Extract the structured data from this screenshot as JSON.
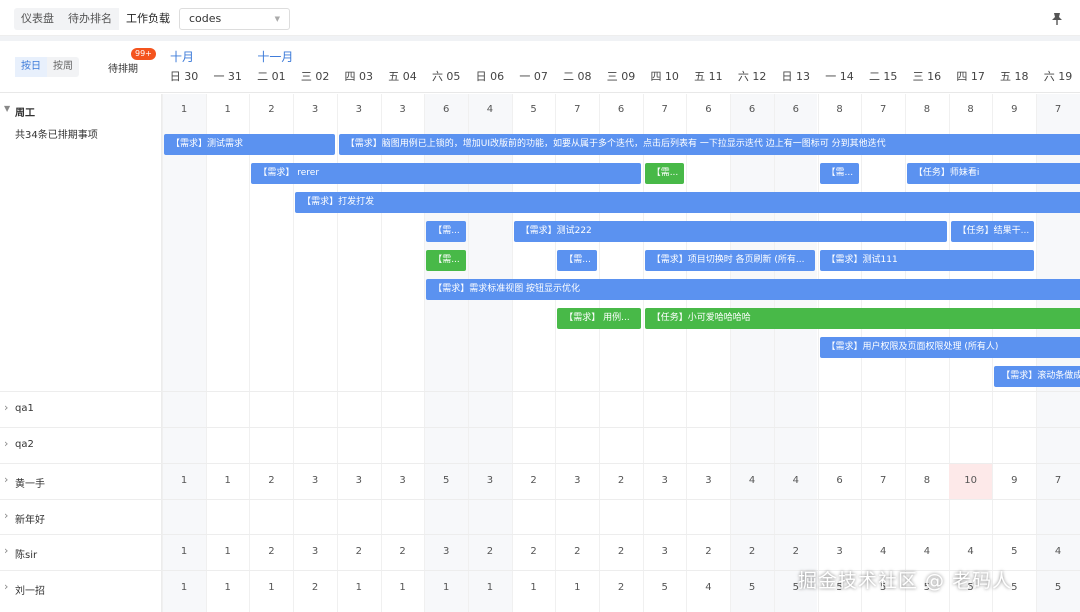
{
  "tabs": [
    {
      "label": "仪表盘"
    },
    {
      "label": "待办排名"
    },
    {
      "label": "工作负载"
    }
  ],
  "select": {
    "value": "codes"
  },
  "header": {
    "seg": [
      "按日",
      "按周"
    ],
    "pending": "待排期",
    "badge": "99+"
  },
  "months": [
    {
      "label": "十月",
      "col": 0
    },
    {
      "label": "十一月",
      "col": 2
    }
  ],
  "days": [
    "日 30",
    "一 31",
    "二 01",
    "三 02",
    "四 03",
    "五 04",
    "六 05",
    "日 06",
    "一 07",
    "二 08",
    "三 09",
    "四 10",
    "五 11",
    "六 12",
    "日 13",
    "一 14",
    "二 15",
    "三 16",
    "四 17",
    "五 18",
    "六 19"
  ],
  "weekend_cols": [
    0,
    6,
    7,
    13,
    14,
    20
  ],
  "zhougong": {
    "name": "周工",
    "summary": "共34条已排期事项",
    "counts": [
      "1",
      "1",
      "2",
      "3",
      "3",
      "3",
      "6",
      "4",
      "5",
      "7",
      "6",
      "7",
      "6",
      "6",
      "6",
      "8",
      "7",
      "8",
      "8",
      "9",
      "7"
    ]
  },
  "tasks": [
    {
      "row": 0,
      "start": 0,
      "end": 3,
      "label": "【需求】测试需求",
      "color": "blue"
    },
    {
      "row": 0,
      "start": 4,
      "end": 21,
      "label": "【需求】脑图用例已上锁的，增加UI改版前的功能，如要从属于多个迭代，点击后列表有 一下拉显示迭代 边上有一图标可 分到其他迭代",
      "color": "blue"
    },
    {
      "row": 1,
      "start": 2,
      "end": 10,
      "label": "【需求】 rerer",
      "color": "blue"
    },
    {
      "row": 1,
      "start": 11,
      "end": 11,
      "label": "【需...",
      "color": "green"
    },
    {
      "row": 1,
      "start": 15,
      "end": 15,
      "label": "【需...",
      "color": "blue"
    },
    {
      "row": 1,
      "start": 17,
      "end": 21,
      "label": "【任务】师妹看i",
      "color": "blue"
    },
    {
      "row": 2,
      "start": 3,
      "end": 21,
      "label": "【需求】打发打发",
      "color": "blue"
    },
    {
      "row": 3,
      "start": 6,
      "end": 6,
      "label": "【需...",
      "color": "blue"
    },
    {
      "row": 3,
      "start": 8,
      "end": 17,
      "label": "【需求】测试222",
      "color": "blue"
    },
    {
      "row": 3,
      "start": 18,
      "end": 19,
      "label": "【任务】结果干...",
      "color": "blue"
    },
    {
      "row": 4,
      "start": 6,
      "end": 6,
      "label": "【需...",
      "color": "green"
    },
    {
      "row": 4,
      "start": 9,
      "end": 9,
      "label": "【需...",
      "color": "blue"
    },
    {
      "row": 4,
      "start": 11,
      "end": 14,
      "label": "【需求】项目切换时 各页刷新 (所有...",
      "color": "blue"
    },
    {
      "row": 4,
      "start": 15,
      "end": 19,
      "label": "【需求】测试111",
      "color": "blue"
    },
    {
      "row": 5,
      "start": 6,
      "end": 21,
      "label": "【需求】需求标准视图 按钮显示优化",
      "color": "blue"
    },
    {
      "row": 6,
      "start": 9,
      "end": 10,
      "label": "【需求】 用例...",
      "color": "green"
    },
    {
      "row": 6,
      "start": 11,
      "end": 21,
      "label": "【任务】小可爱哈哈哈哈",
      "color": "green"
    },
    {
      "row": 7,
      "start": 15,
      "end": 21,
      "label": "【需求】用户权限及页面权限处理 (所有人)",
      "color": "blue"
    },
    {
      "row": 8,
      "start": 19,
      "end": 21,
      "label": "【需求】滚动条做成",
      "color": "blue"
    }
  ],
  "members": [
    {
      "name": "qa1",
      "counts": []
    },
    {
      "name": "qa2",
      "counts": []
    },
    {
      "name": "黄一手",
      "counts": [
        "1",
        "1",
        "2",
        "3",
        "3",
        "3",
        "5",
        "3",
        "2",
        "3",
        "2",
        "3",
        "3",
        "4",
        "4",
        "6",
        "7",
        "8",
        "10",
        "9",
        "7"
      ],
      "highlight": 18
    },
    {
      "name": "新年好",
      "counts": []
    },
    {
      "name": "陈sir",
      "counts": [
        "1",
        "1",
        "2",
        "3",
        "2",
        "2",
        "3",
        "2",
        "2",
        "2",
        "2",
        "3",
        "2",
        "2",
        "2",
        "3",
        "4",
        "4",
        "4",
        "5",
        "4"
      ]
    },
    {
      "name": "刘一招",
      "counts": [
        "1",
        "1",
        "1",
        "2",
        "1",
        "1",
        "1",
        "1",
        "1",
        "1",
        "2",
        "5",
        "4",
        "5",
        "5",
        "5",
        "5",
        "5",
        "5",
        "5",
        "5"
      ]
    }
  ],
  "watermark": "掘金技术社区 @ 老码人",
  "colors": {
    "accent": "#3d7bd9",
    "task_blue": "#5b92f0",
    "task_green": "#48b948",
    "badge": "#f4541e",
    "highlight": "#fde9e9"
  }
}
